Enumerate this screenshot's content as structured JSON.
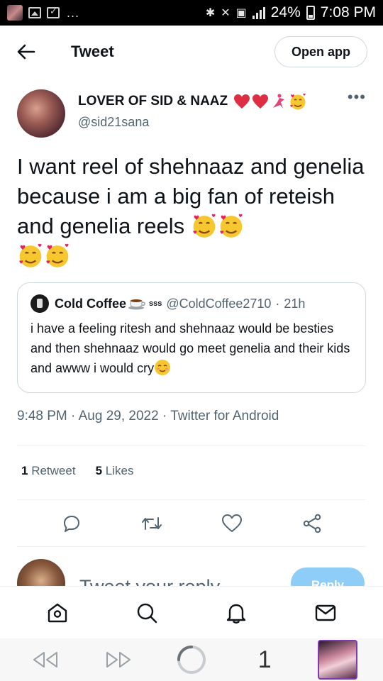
{
  "status_bar": {
    "battery": "24%",
    "time": "7:08 PM",
    "overflow": "..."
  },
  "header": {
    "title": "Tweet",
    "open_app_label": "Open app"
  },
  "tweet": {
    "author": {
      "display_name": "LOVER OF SID & NAAZ",
      "handle": "@sid21sana",
      "emojis": [
        "red-heart",
        "red-heart",
        "dancer",
        "smiling-face-with-hearts"
      ]
    },
    "text": "I want reel of shehnaaz and genelia because i am a big fan of reteish and genelia reels",
    "text_emojis": [
      "smiling-face-with-hearts",
      "smiling-face-with-hearts",
      "smiling-face-with-hearts",
      "smiling-face-with-hearts"
    ],
    "quoted": {
      "name": "Cold Coffee",
      "name_suffix": "sss",
      "handle": "@ColdCoffee2710",
      "separator": "·",
      "time": "21h",
      "text": "i have a feeling ritesh and shehnaaz would be besties and then shehnaaz would go meet genelia and their kids and awww i would cry",
      "trailing_emoji": "relieved-face"
    },
    "meta": {
      "time": "9:48 PM",
      "date": "Aug 29, 2022",
      "source": "Twitter for Android",
      "separator": "·"
    },
    "stats": {
      "retweets_count": "1",
      "retweets_label": "Retweet",
      "likes_count": "5",
      "likes_label": "Likes"
    }
  },
  "reply": {
    "placeholder": "Tweet your reply",
    "button_label": "Reply"
  },
  "tabbar": {
    "items": [
      "home-icon",
      "search-icon",
      "notifications-icon",
      "messages-icon"
    ]
  },
  "browser_nav": {
    "tab_count": "1"
  },
  "colors": {
    "text_primary": "#0f1419",
    "text_secondary": "#536471",
    "border": "#cfd9de",
    "reply_button": "#8ecdf8",
    "tabs_thumb_border": "#7c3bb0"
  }
}
